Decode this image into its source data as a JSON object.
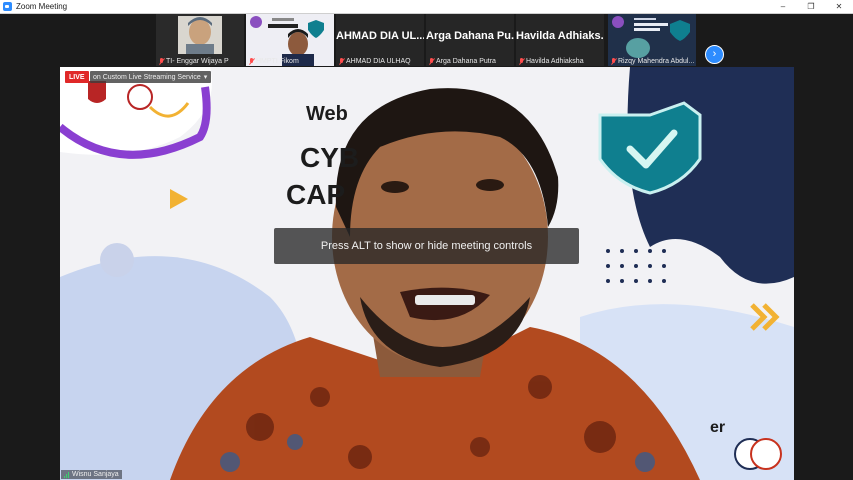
{
  "window": {
    "title": "Zoom Meeting",
    "controls": {
      "minimize": "–",
      "maximize": "❐",
      "close": "✕"
    }
  },
  "participants": [
    {
      "name_short": "",
      "label": "TI- Enggar Wijaya P",
      "muted": true
    },
    {
      "name_short": "",
      "label": "HMPTI Fikom",
      "muted": true
    },
    {
      "name_short": "AHMAD DIA UL...",
      "label": "AHMAD DIA ULHAQ",
      "muted": true
    },
    {
      "name_short": "Arga Dahana Pu...",
      "label": "Arga Dahana Putra",
      "muted": true
    },
    {
      "name_short": "Havilda Adhiaks...",
      "label": "Havilda Adhiaksha",
      "muted": true
    },
    {
      "name_short": "",
      "label": "Rizqy Mahendra Abdul...",
      "muted": true
    }
  ],
  "strip": {
    "next_icon": "chevron-right-icon",
    "next_glyph": "›"
  },
  "main_video": {
    "live_badge": "LIVE",
    "stream_target": "on Custom Live Streaming Service",
    "stream_caret": "▾",
    "banner_words": [
      "Web",
      "CYB",
      "CAP"
    ],
    "banner_right_word": "er",
    "toast": "Press ALT to show or hide meeting controls",
    "speaker_name": "Wisnu Sanjaya"
  },
  "colors": {
    "zoom_blue": "#2d8cff",
    "live_red": "#e02828",
    "mute_red": "#ff4d4d",
    "shield_teal": "#0f7f8f",
    "accent_orange": "#f2b233"
  }
}
